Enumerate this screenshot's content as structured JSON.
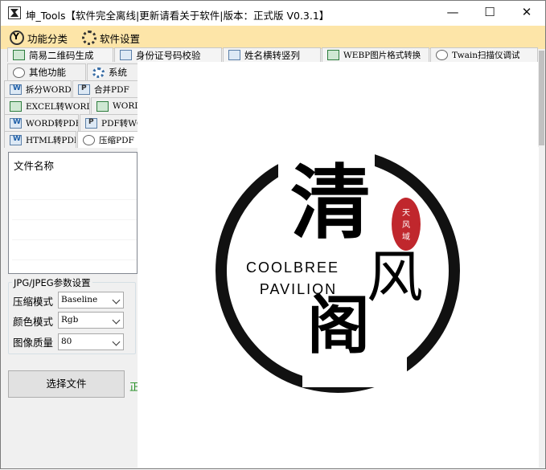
{
  "titlebar": {
    "title": "坤_Tools【软件完全离线|更新请看关于软件|版本：正式版 V0.3.1】",
    "minimize": "—",
    "maximize": "☐",
    "close": "✕"
  },
  "menu": {
    "items": [
      {
        "label": "功能分类",
        "icon": "category-icon"
      },
      {
        "label": "软件设置",
        "icon": "gear-icon"
      }
    ]
  },
  "tabs": {
    "row1": [
      "简易二维码生成",
      "身份证号码校验",
      "姓名横转竖列",
      "WEBP图片格式转换",
      "Twain扫描仪调试"
    ],
    "row2": [
      "其他功能",
      "系统"
    ],
    "row3": [
      "拆分WORD",
      "合并PDF"
    ],
    "row4": [
      "EXCEL转WORD",
      "WORD"
    ],
    "row5": [
      "WORD转PDF",
      "PDF转WO"
    ],
    "row6": [
      "HTML转PDF",
      "压缩PDF"
    ]
  },
  "file_list": {
    "header": "文件名称"
  },
  "params": {
    "group_title": "JPG/JPEG参数设置",
    "compress_label": "压缩模式",
    "compress_value": "Baseline",
    "color_label": "颜色模式",
    "color_value": "Rgb",
    "quality_label": "图像质量",
    "quality_value": "80"
  },
  "actions": {
    "choose_file": "选择文件",
    "status": "正"
  },
  "logo": {
    "char1": "清",
    "char2": "风",
    "char3": "阁",
    "line1": "COOLBREE",
    "line2": "PAVILION",
    "seal": [
      "天",
      "风",
      "域"
    ]
  },
  "colors": {
    "menubar": "#fde5a8",
    "seal_red": "#c0272d"
  }
}
